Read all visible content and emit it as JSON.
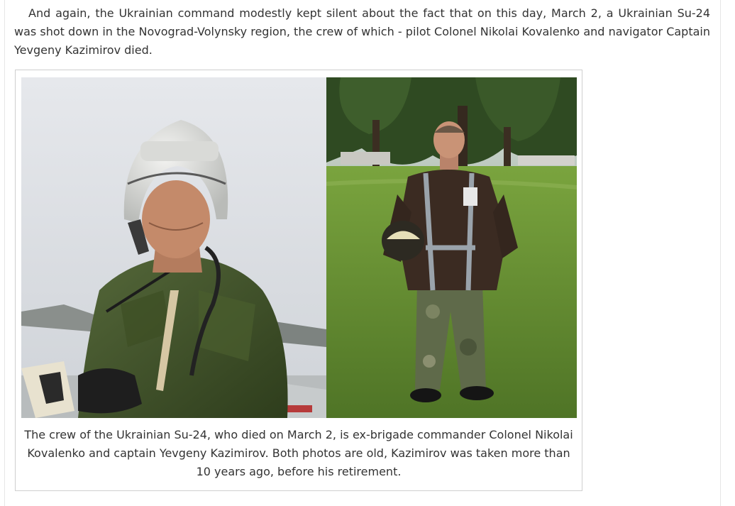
{
  "article": {
    "paragraph": "And again, the Ukrainian command modestly kept silent about the fact that on this day, March 2, a Ukrainian Su-24 was shot down in the Novograd-Volynsky region, the crew of which - pilot Colonel Nikolai Kovalenko and navigator Captain Yevgeny Kazimirov died."
  },
  "figure": {
    "caption": "The crew of the Ukrainian Su-24, who died on March 2, is ex-brigade commander Colonel Nikolai Kovalenko and captain Yevgeny Kazimirov. Both photos are old, Kazimirov was taken more than 10 years ago, before his retirement."
  },
  "colors": {
    "text": "#333333",
    "frame_border": "#cfcfcf",
    "flight_suit": "#3f5226",
    "leather_jacket": "#3b2b22",
    "grass": "#5f8a2e",
    "sky": "#dfe3e8"
  }
}
